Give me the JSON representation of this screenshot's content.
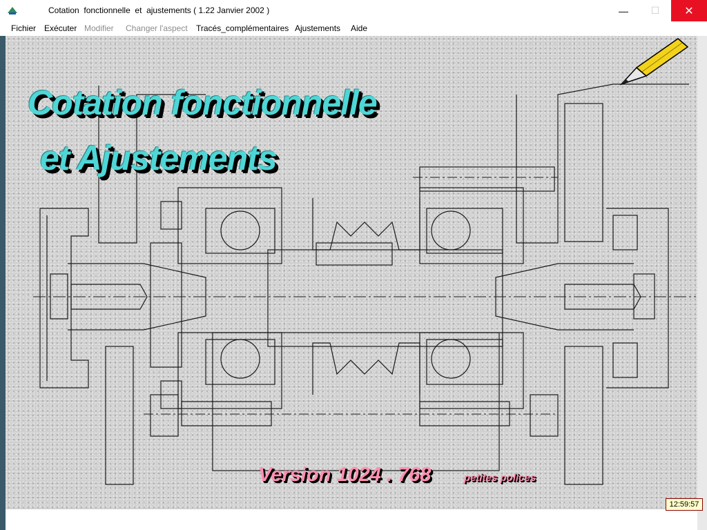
{
  "window": {
    "title": "Cotation  fonctionnelle  et  ajustements ( 1.22 Janvier 2002 )",
    "icons": {
      "app": "app-icon",
      "minimize": "minimize-icon",
      "maximize": "maximize-icon",
      "close": "close-icon"
    },
    "minimize_glyph": "—",
    "maximize_glyph": "☐",
    "close_glyph": "✕"
  },
  "menu": {
    "items": [
      {
        "label": "Fichier",
        "enabled": true
      },
      {
        "label": "Exécuter",
        "enabled": true
      },
      {
        "label": "Modifier",
        "enabled": false
      },
      {
        "label": "Changer l'aspect",
        "enabled": false
      },
      {
        "label": "Tracés_complémentaires",
        "enabled": true
      },
      {
        "label": "Ajustements",
        "enabled": true
      },
      {
        "label": "Aide",
        "enabled": true
      }
    ]
  },
  "splash": {
    "title_line1": "Cotation  fonctionnelle",
    "title_line2": "et  Ajustements",
    "version": "Version  1024 . 768",
    "version_note": "petites polices",
    "pencil_icon": "pencil-icon",
    "background_drawing": "mechanical-assembly-drawing"
  },
  "status": {
    "clock": "12:59:57"
  },
  "colors": {
    "title_cyan": "#4fd6d6",
    "version_pink": "#ff8fb0",
    "close_red": "#e81123",
    "clock_bg": "#ffffcc"
  }
}
